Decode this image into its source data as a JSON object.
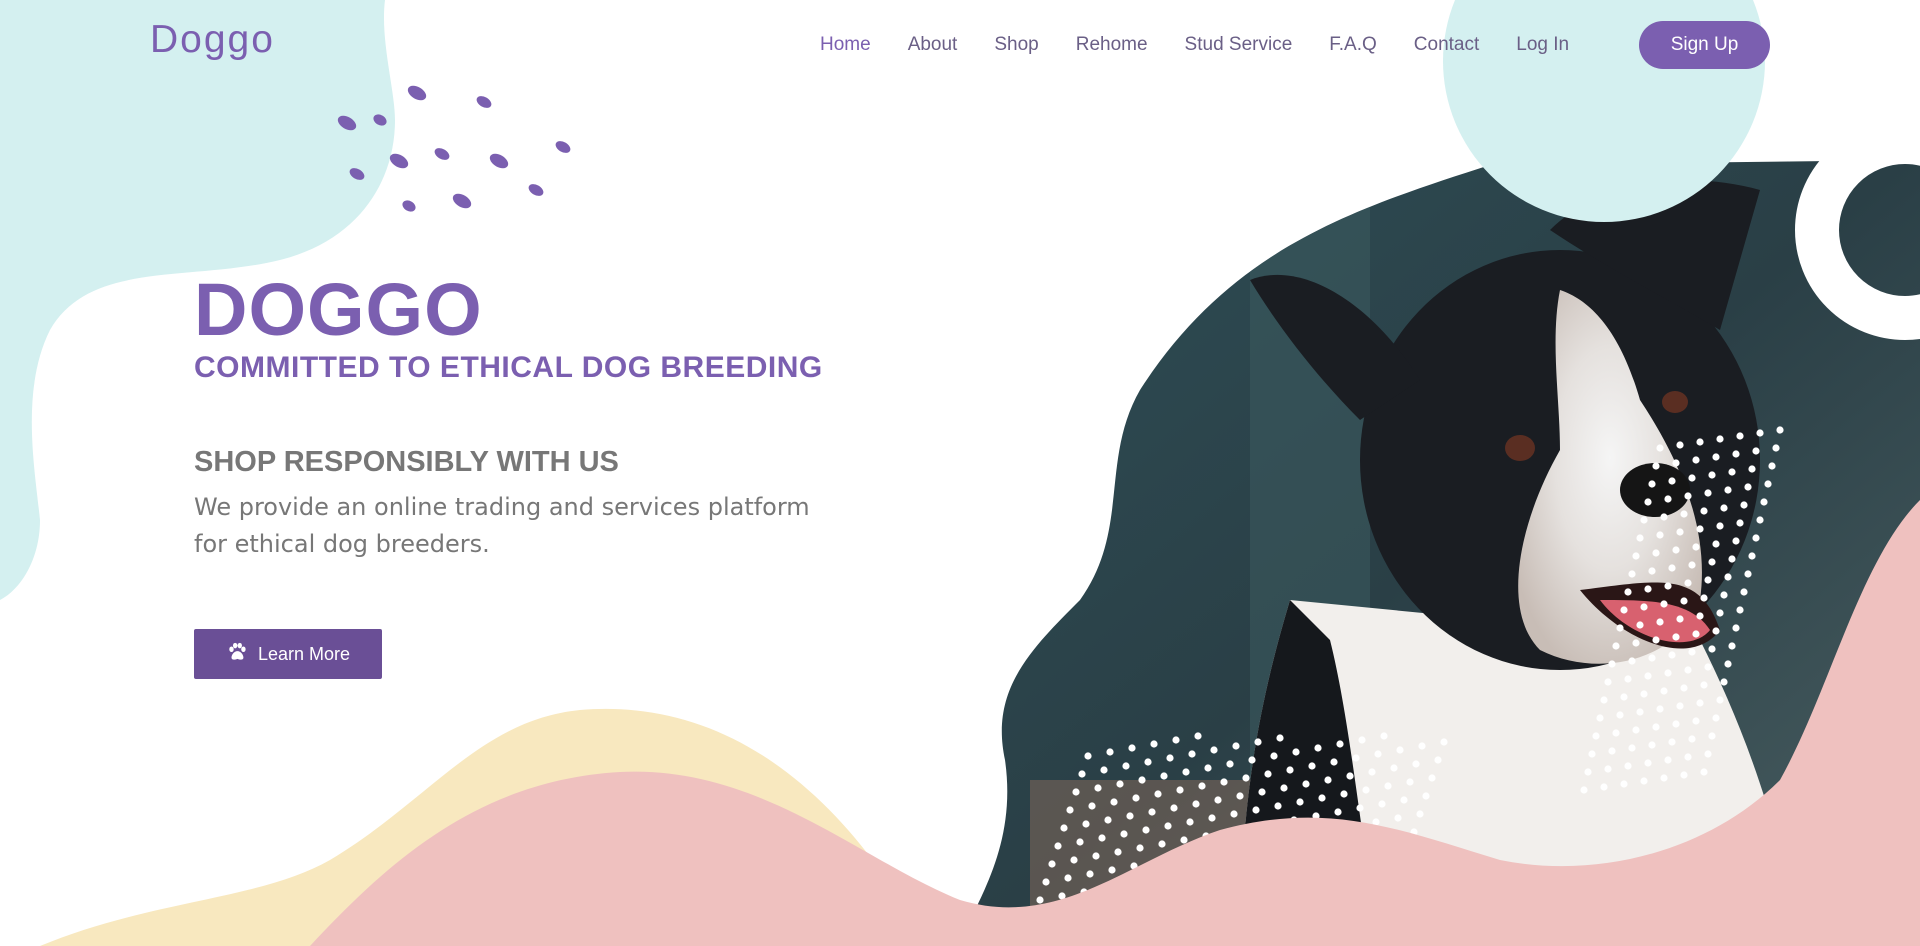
{
  "header": {
    "logo": "Doggo",
    "nav": [
      {
        "label": "Home",
        "active": true
      },
      {
        "label": "About"
      },
      {
        "label": "Shop"
      },
      {
        "label": "Rehome"
      },
      {
        "label": "Stud Service"
      },
      {
        "label": "F.A.Q"
      },
      {
        "label": "Contact"
      },
      {
        "label": "Log In"
      }
    ],
    "signup_label": "Sign Up"
  },
  "hero": {
    "title": "DOGGO",
    "subtitle": "COMMITTED TO ETHICAL DOG BREEDING",
    "section_heading": "SHOP RESPONSIBLY WITH US",
    "section_text": "We provide an online trading and services platform for ethical dog breeders.",
    "cta_label": "Learn More",
    "cta_icon": "paw-icon"
  },
  "colors": {
    "brand_purple": "#7b5fb0",
    "button_purple": "#6a4f96",
    "mint": "#d4f0f0",
    "pink": "#efc1bf",
    "cream": "#f8e8bf",
    "text_gray": "#777777"
  },
  "hero_image": "photo of black and white border collie with open mouth"
}
